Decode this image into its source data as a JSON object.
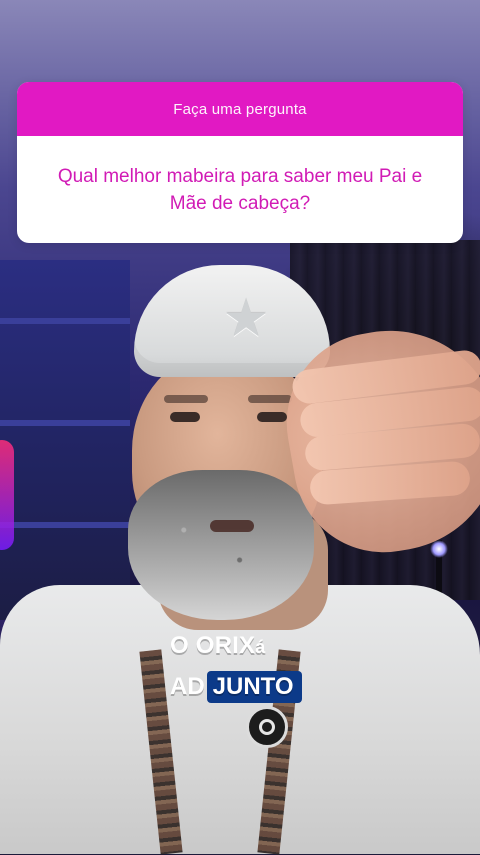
{
  "question_sticker": {
    "header_text": "Faça uma pergunta",
    "question_text": "Qual melhor mabeira para saber meu Pai e Mãe de cabeça?",
    "header_color": "#e119c3",
    "question_color": "#d11bb5"
  },
  "caption": {
    "line1_prefix": "O ORIX",
    "line1_suffix": "á",
    "line2_plain": "AD",
    "line2_boxed": "JUNTO",
    "box_color": "#0c3a89"
  },
  "icons": {
    "cap_star": "star-icon",
    "collar_pin": "pin-icon"
  }
}
